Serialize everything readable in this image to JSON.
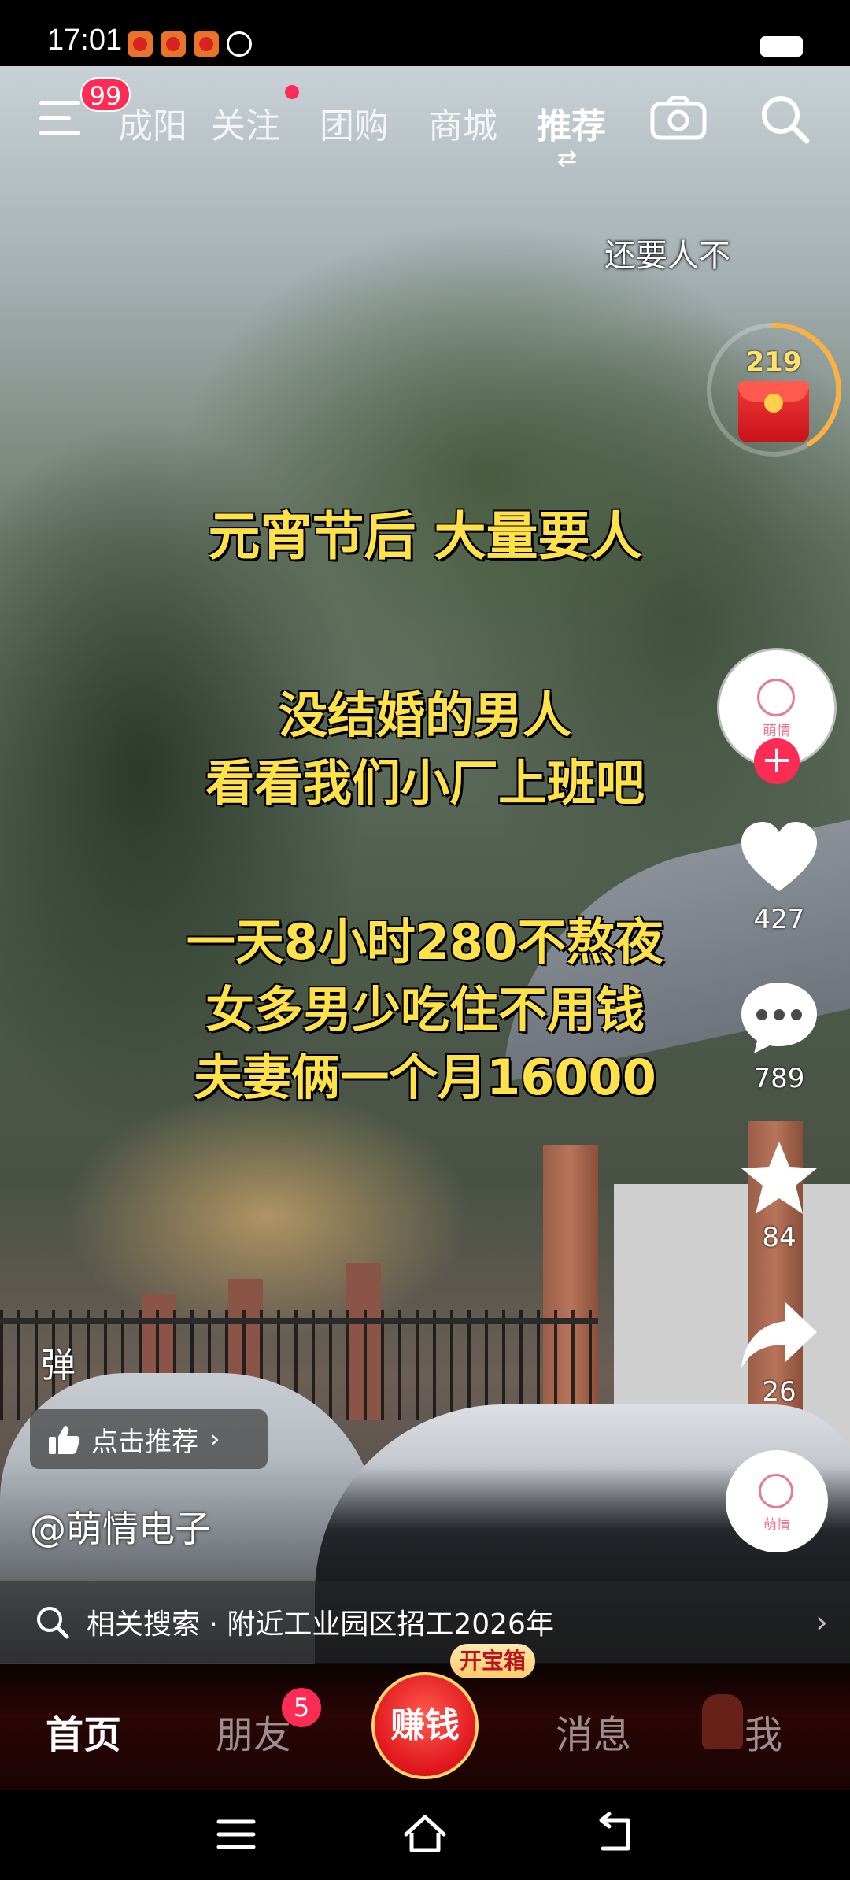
{
  "status_bar": {
    "time": "17:01"
  },
  "top_nav": {
    "menu_badge": "99",
    "tabs": [
      "成阳",
      "关注",
      "团购",
      "商城",
      "推荐"
    ],
    "active_tab": "推荐"
  },
  "video": {
    "corner_text": "还要人不",
    "headline": "元宵节后 大量要人",
    "lines": [
      "没结婚的男人",
      "看看我们小厂上班吧",
      "一天8小时280不熬夜",
      "女多男少吃住不用钱",
      "夫妻俩一个月16000"
    ]
  },
  "red_packet": {
    "count": "219"
  },
  "author_avatar": {
    "logo_text": "萌情"
  },
  "actions": {
    "likes": "427",
    "comments": "789",
    "favorites": "84",
    "shares": "26"
  },
  "overlay": {
    "danmu_label": "弹",
    "recommend_label": "点击推荐",
    "author": "@萌情电子",
    "related_search": "相关搜索 · 附近工业园区招工2026年"
  },
  "bottom_nav": {
    "home": "首页",
    "friends": "朋友",
    "friends_badge": "5",
    "earn": "赚钱",
    "treasure": "开宝箱",
    "messages": "消息",
    "me": "我"
  },
  "colors": {
    "accent": "#fe2c55",
    "caption": "#ffe24a"
  }
}
